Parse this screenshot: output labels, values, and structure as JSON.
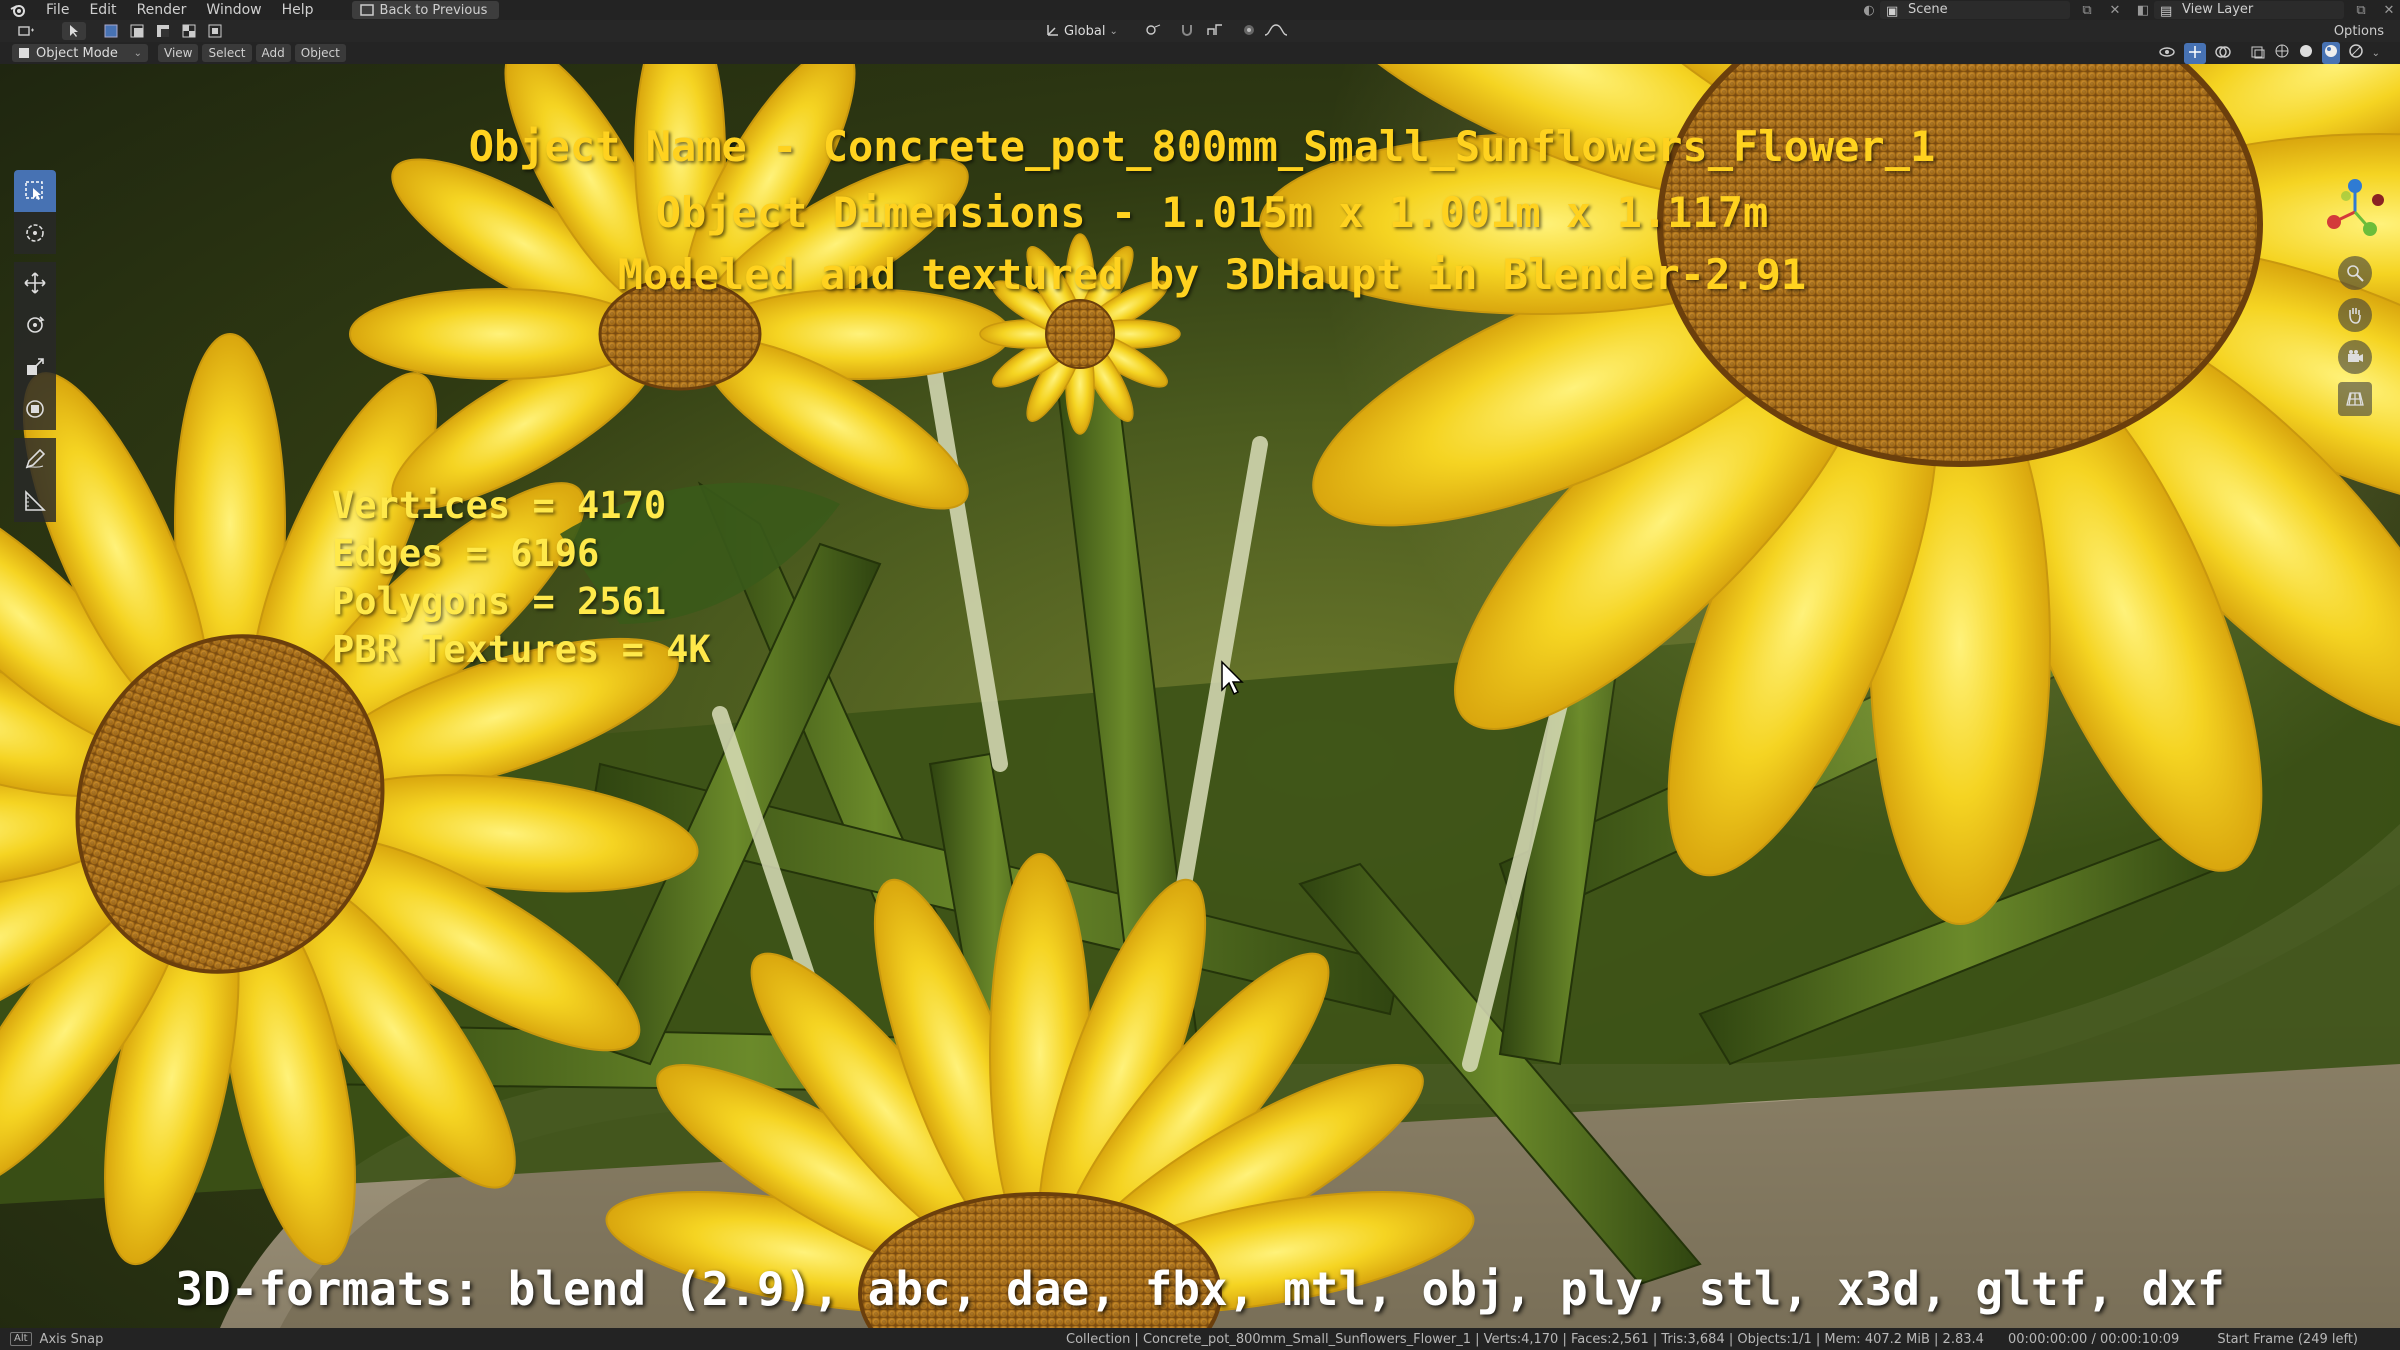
{
  "menu": {
    "items": [
      "File",
      "Edit",
      "Render",
      "Window",
      "Help"
    ],
    "back_button": "Back to Previous"
  },
  "topright": {
    "scene_label": "Scene",
    "view_layer_label": "View Layer"
  },
  "header": {
    "mode": "Object Mode",
    "view": "View",
    "select": "Select",
    "add": "Add",
    "object": "Object",
    "orientation": "Global",
    "options": "Options"
  },
  "overlay": {
    "title_line1": "Object Name - Concrete_pot_800mm_Small_Sunflowers_Flower_1",
    "title_line2": "Object Dimensions -  1.015m x 1.001m x 1.117m",
    "title_line3": "Modeled and textured by 3DHaupt in Blender-2.91",
    "stats": [
      "Vertices = 4170",
      "Edges = 6196",
      "Polygons = 2561",
      "PBR Textures = 4K"
    ],
    "formats": "3D-formats: blend (2.9), abc, dae, fbx, mtl, obj, ply, stl, x3d, gltf, dxf"
  },
  "statusbar": {
    "key": "Alt",
    "hint": "Axis Snap",
    "info": "Collection | Concrete_pot_800mm_Small_Sunflowers_Flower_1 | Verts:4,170 | Faces:2,561 | Tris:3,684 | Objects:1/1 | Mem: 407.2 MiB | 2.83.4",
    "time": "00:00:00:00 / 00:00:10:09",
    "frame": "Start Frame (249 left)"
  },
  "colors": {
    "accent": "#4772b3",
    "title_text": "#ffd21f",
    "stats_text": "#ffe94a",
    "petal": "#f5d422",
    "seed_center": "#b5791c",
    "leaf": "#4e6b1f"
  }
}
